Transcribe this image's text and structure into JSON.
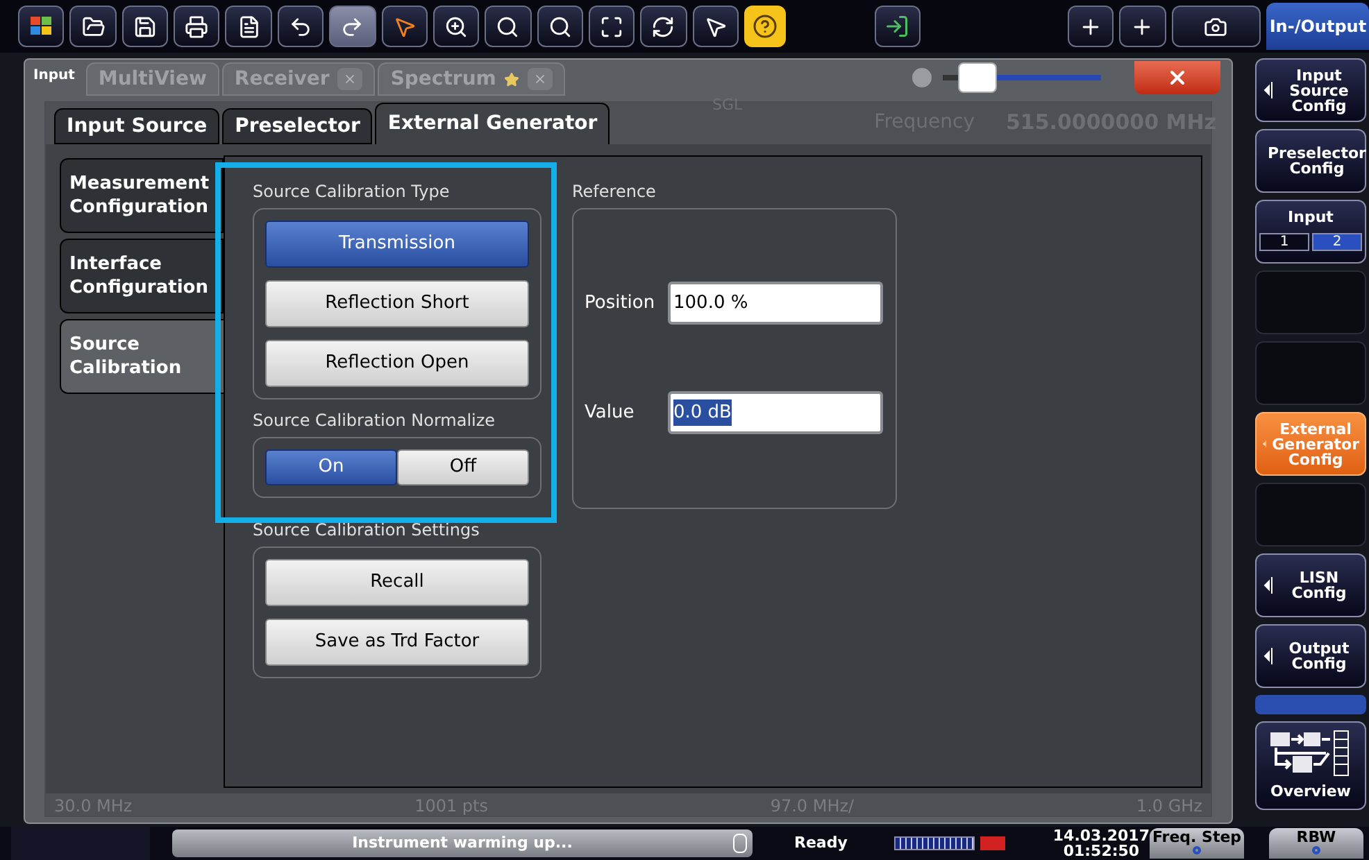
{
  "toolbar": {
    "mode_button": "In-/Output"
  },
  "dialog": {
    "title": "Input",
    "transparency": {
      "level": 0.2
    },
    "background_tabs": [
      {
        "label": "MultiView",
        "closable": false
      },
      {
        "label": "Receiver",
        "closable": true
      },
      {
        "label": "Spectrum",
        "closable": true
      }
    ],
    "background_info": {
      "sweep": "SGL",
      "frequency_label": "Frequency",
      "frequency_value": "515.0000000 MHz",
      "axis": [
        "30.0 MHz",
        "1001 pts",
        "97.0 MHz/",
        "1.0 GHz"
      ]
    },
    "tabs": [
      {
        "label": "Input Source",
        "selected": false
      },
      {
        "label": "Preselector",
        "selected": false
      },
      {
        "label": "External Generator",
        "selected": true
      }
    ],
    "side_tabs": [
      {
        "label": "Measurement Configuration",
        "selected": false
      },
      {
        "label": "Interface Configuration",
        "selected": false
      },
      {
        "label": "Source Calibration",
        "selected": true
      }
    ],
    "calibration_type": {
      "title": "Source Calibration Type",
      "options": [
        {
          "label": "Transmission",
          "selected": true
        },
        {
          "label": "Reflection Short",
          "selected": false
        },
        {
          "label": "Reflection Open",
          "selected": false
        }
      ]
    },
    "normalize": {
      "title": "Source Calibration Normalize",
      "options": [
        {
          "label": "On",
          "selected": true
        },
        {
          "label": "Off",
          "selected": false
        }
      ]
    },
    "settings": {
      "title": "Source Calibration Settings",
      "buttons": [
        "Recall",
        "Save as Trd Factor"
      ]
    },
    "reference": {
      "title": "Reference",
      "fields": [
        {
          "label": "Position",
          "value": "100.0 %",
          "selected": false
        },
        {
          "label": "Value",
          "value": "0.0 dB",
          "selected": true
        }
      ]
    }
  },
  "softkeys": [
    {
      "kind": "submenu",
      "label": "Input Source Config",
      "selected": false
    },
    {
      "kind": "submenu",
      "label": "Preselector Config",
      "selected": false
    },
    {
      "kind": "toggle",
      "label": "Input",
      "options": [
        {
          "label": "1",
          "selected": false
        },
        {
          "label": "2",
          "selected": true
        }
      ]
    },
    {
      "kind": "empty"
    },
    {
      "kind": "empty"
    },
    {
      "kind": "submenu",
      "label": "External Generator Config",
      "selected": true
    },
    {
      "kind": "empty"
    },
    {
      "kind": "submenu",
      "label": "LISN Config",
      "selected": false
    },
    {
      "kind": "submenu",
      "label": "Output Config",
      "selected": false
    },
    {
      "kind": "bar"
    },
    {
      "kind": "overview",
      "label": "Overview"
    }
  ],
  "status": {
    "message": "Instrument warming up...",
    "state": "Ready",
    "date": "14.03.2017",
    "time": "01:52:50",
    "keys": [
      "Freq. Step",
      "RBW"
    ]
  }
}
